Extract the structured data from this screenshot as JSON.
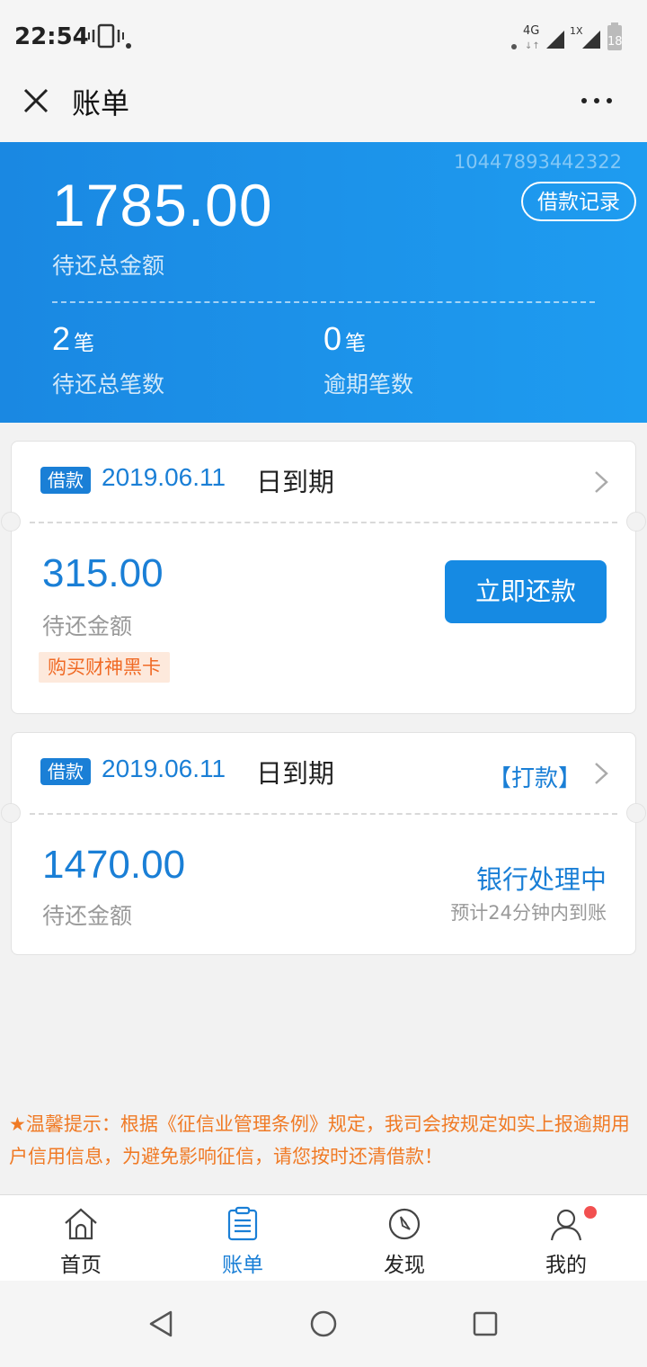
{
  "status_bar": {
    "time": "22:54",
    "network": "4G",
    "network2": "1X",
    "battery": "18"
  },
  "header": {
    "title": "账单"
  },
  "summary": {
    "account_id": "10447893442322",
    "loan_record_label": "借款记录",
    "total_amount": "1785.00",
    "total_label": "待还总金额",
    "pending_count": "2",
    "pending_unit": "笔",
    "pending_label": "待还总笔数",
    "overdue_count": "0",
    "overdue_unit": "笔",
    "overdue_label": "逾期笔数"
  },
  "bills": [
    {
      "tag": "借款",
      "due_date": "2019.06.11",
      "due_suffix": "日到期",
      "amount": "315.00",
      "amount_label": "待还金额",
      "promo": "购买财神黑卡",
      "action_label": "立即还款"
    },
    {
      "tag": "借款",
      "due_date": "2019.06.11",
      "due_suffix": "日到期",
      "transfer_label": "【打款】",
      "amount": "1470.00",
      "amount_label": "待还金额",
      "status": "银行处理中",
      "eta": "预计24分钟内到账"
    }
  ],
  "notice": "★温馨提示：根据《征信业管理条例》规定，我司会按规定如实上报逾期用户信用信息，为避免影响征信，请您按时还清借款！",
  "tabs": [
    {
      "label": "首页",
      "icon": "home-icon"
    },
    {
      "label": "账单",
      "icon": "bill-icon",
      "active": true
    },
    {
      "label": "发现",
      "icon": "compass-icon"
    },
    {
      "label": "我的",
      "icon": "user-icon",
      "badge": true
    }
  ],
  "colors": {
    "primary": "#1a7fd6",
    "banner": "#1e8fe6",
    "warning": "#f07a25",
    "badge": "#f25050"
  }
}
